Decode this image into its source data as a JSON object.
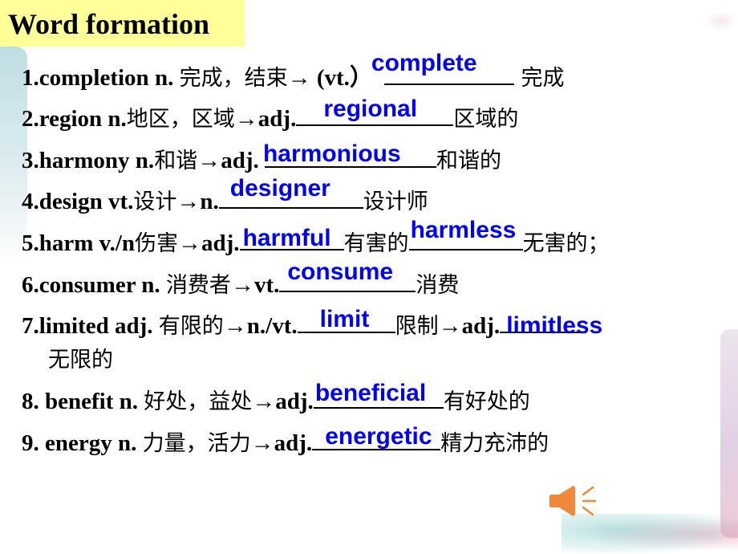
{
  "title": "Word formation",
  "colors": {
    "title_bg": "#ffff99",
    "answer": "#0000ff",
    "text": "#000000",
    "speaker": "#f0883a"
  },
  "items": [
    {
      "num": "1.",
      "word": "completion",
      "pos": " n. ",
      "meaning": "完成，结束",
      "arrow": "→ ",
      "target_pos": "(vt.）",
      "answer": "complete",
      "after": " 完成"
    },
    {
      "num": "2.",
      "word": "region",
      "pos": " n.",
      "meaning": "地区，区域",
      "arrow": "→",
      "target_pos": "adj.",
      "answer": "regional",
      "after": "区域的"
    },
    {
      "num": "3.",
      "word": "harmony",
      "pos": " n.",
      "meaning": "和谐",
      "arrow": "→",
      "target_pos": "adj. ",
      "answer": "harmonious",
      "after": "和谐的"
    },
    {
      "num": "4.",
      "word": "design",
      "pos": " vt.",
      "meaning": "设计",
      "arrow": "→",
      "target_pos": "n.",
      "answer": "designer",
      "after": "设计师"
    },
    {
      "num": "5.",
      "word": "harm",
      "pos": " v./n",
      "meaning": "伤害",
      "arrow": "→",
      "target_pos": "adj.",
      "answer": "harmful",
      "after": "有害的",
      "answer2": "harmless",
      "after2": "无害的；"
    },
    {
      "num": "6.",
      "word": "consumer",
      "pos": " n. ",
      "meaning": "消费者",
      "arrow": "→",
      "target_pos": "vt.",
      "answer": "consume",
      "after": "消费"
    },
    {
      "num": "7.",
      "word": "limited",
      "pos": " adj. ",
      "meaning": "有限的",
      "arrow": "→",
      "target_pos": "n./vt.",
      "answer": "limit",
      "after": "限制",
      "arrow2": "→",
      "target_pos2": "adj.",
      "answer2": "limitless",
      "after2": "无限的"
    },
    {
      "num": "8. ",
      "word": "benefit",
      "pos": " n. ",
      "meaning": "好处，益处",
      "arrow": "→",
      "target_pos": "adj.",
      "answer": "beneficial",
      "after": "有好处的"
    },
    {
      "num": "9. ",
      "word": "energy",
      "pos": " n. ",
      "meaning": "力量，活力",
      "arrow": "→",
      "target_pos": "adj.",
      "answer": "energetic",
      "after": "精力充沛的"
    }
  ],
  "speaker_icon": "speaker-sound-icon"
}
